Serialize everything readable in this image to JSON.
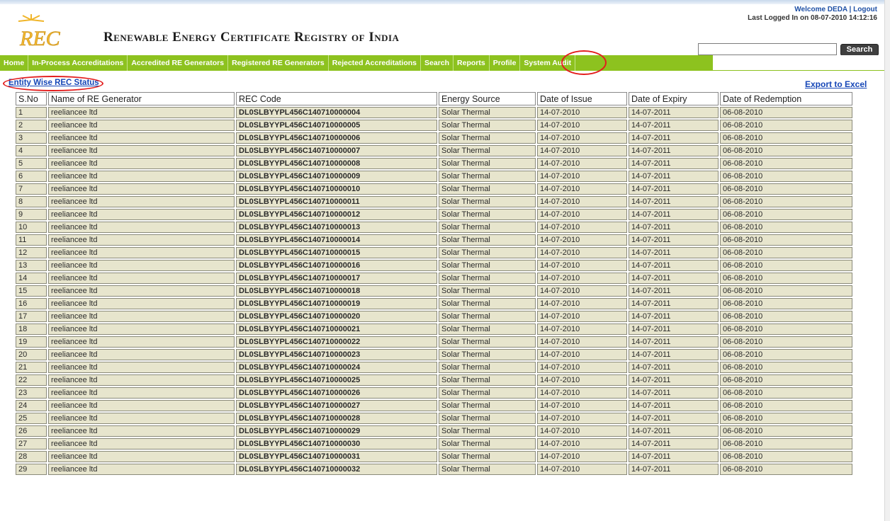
{
  "header": {
    "site_title": "Renewable Energy Certificate Registry of India",
    "welcome_text": "Welcome DEDA",
    "separator": " | ",
    "logout_label": "Logout",
    "last_logged_in": "Last Logged In on 08-07-2010 14:12:16",
    "search_placeholder": "",
    "search_button_label": "Search"
  },
  "nav": [
    "Home",
    "In-Process Accreditations",
    "Accredited RE Generators",
    "Registered RE Generators",
    "Rejected Accreditations",
    "Search",
    "Reports",
    "Profile",
    "System Audit"
  ],
  "page": {
    "heading": "Entity Wise REC Status",
    "export_label": "Export to Excel"
  },
  "colors": {
    "nav_green": "#8dc21f",
    "link_blue": "#1546b7",
    "highlight_red": "#e31d1d",
    "row_bg": "#e7e5cd"
  },
  "table": {
    "columns": [
      "S.No",
      "Name of RE Generator",
      "REC Code",
      "Energy Source",
      "Date of Issue",
      "Date of Expiry",
      "Date of Redemption"
    ],
    "rows": [
      [
        "1",
        "reeliancee ltd",
        "DL0SLBYYPL456C140710000004",
        "Solar Thermal",
        "14-07-2010",
        "14-07-2011",
        "06-08-2010"
      ],
      [
        "2",
        "reeliancee ltd",
        "DL0SLBYYPL456C140710000005",
        "Solar Thermal",
        "14-07-2010",
        "14-07-2011",
        "06-08-2010"
      ],
      [
        "3",
        "reeliancee ltd",
        "DL0SLBYYPL456C140710000006",
        "Solar Thermal",
        "14-07-2010",
        "14-07-2011",
        "06-08-2010"
      ],
      [
        "4",
        "reeliancee ltd",
        "DL0SLBYYPL456C140710000007",
        "Solar Thermal",
        "14-07-2010",
        "14-07-2011",
        "06-08-2010"
      ],
      [
        "5",
        "reeliancee ltd",
        "DL0SLBYYPL456C140710000008",
        "Solar Thermal",
        "14-07-2010",
        "14-07-2011",
        "06-08-2010"
      ],
      [
        "6",
        "reeliancee ltd",
        "DL0SLBYYPL456C140710000009",
        "Solar Thermal",
        "14-07-2010",
        "14-07-2011",
        "06-08-2010"
      ],
      [
        "7",
        "reeliancee ltd",
        "DL0SLBYYPL456C140710000010",
        "Solar Thermal",
        "14-07-2010",
        "14-07-2011",
        "06-08-2010"
      ],
      [
        "8",
        "reeliancee ltd",
        "DL0SLBYYPL456C140710000011",
        "Solar Thermal",
        "14-07-2010",
        "14-07-2011",
        "06-08-2010"
      ],
      [
        "9",
        "reeliancee ltd",
        "DL0SLBYYPL456C140710000012",
        "Solar Thermal",
        "14-07-2010",
        "14-07-2011",
        "06-08-2010"
      ],
      [
        "10",
        "reeliancee ltd",
        "DL0SLBYYPL456C140710000013",
        "Solar Thermal",
        "14-07-2010",
        "14-07-2011",
        "06-08-2010"
      ],
      [
        "11",
        "reeliancee ltd",
        "DL0SLBYYPL456C140710000014",
        "Solar Thermal",
        "14-07-2010",
        "14-07-2011",
        "06-08-2010"
      ],
      [
        "12",
        "reeliancee ltd",
        "DL0SLBYYPL456C140710000015",
        "Solar Thermal",
        "14-07-2010",
        "14-07-2011",
        "06-08-2010"
      ],
      [
        "13",
        "reeliancee ltd",
        "DL0SLBYYPL456C140710000016",
        "Solar Thermal",
        "14-07-2010",
        "14-07-2011",
        "06-08-2010"
      ],
      [
        "14",
        "reeliancee ltd",
        "DL0SLBYYPL456C140710000017",
        "Solar Thermal",
        "14-07-2010",
        "14-07-2011",
        "06-08-2010"
      ],
      [
        "15",
        "reeliancee ltd",
        "DL0SLBYYPL456C140710000018",
        "Solar Thermal",
        "14-07-2010",
        "14-07-2011",
        "06-08-2010"
      ],
      [
        "16",
        "reeliancee ltd",
        "DL0SLBYYPL456C140710000019",
        "Solar Thermal",
        "14-07-2010",
        "14-07-2011",
        "06-08-2010"
      ],
      [
        "17",
        "reeliancee ltd",
        "DL0SLBYYPL456C140710000020",
        "Solar Thermal",
        "14-07-2010",
        "14-07-2011",
        "06-08-2010"
      ],
      [
        "18",
        "reeliancee ltd",
        "DL0SLBYYPL456C140710000021",
        "Solar Thermal",
        "14-07-2010",
        "14-07-2011",
        "06-08-2010"
      ],
      [
        "19",
        "reeliancee ltd",
        "DL0SLBYYPL456C140710000022",
        "Solar Thermal",
        "14-07-2010",
        "14-07-2011",
        "06-08-2010"
      ],
      [
        "20",
        "reeliancee ltd",
        "DL0SLBYYPL456C140710000023",
        "Solar Thermal",
        "14-07-2010",
        "14-07-2011",
        "06-08-2010"
      ],
      [
        "21",
        "reeliancee ltd",
        "DL0SLBYYPL456C140710000024",
        "Solar Thermal",
        "14-07-2010",
        "14-07-2011",
        "06-08-2010"
      ],
      [
        "22",
        "reeliancee ltd",
        "DL0SLBYYPL456C140710000025",
        "Solar Thermal",
        "14-07-2010",
        "14-07-2011",
        "06-08-2010"
      ],
      [
        "23",
        "reeliancee ltd",
        "DL0SLBYYPL456C140710000026",
        "Solar Thermal",
        "14-07-2010",
        "14-07-2011",
        "06-08-2010"
      ],
      [
        "24",
        "reeliancee ltd",
        "DL0SLBYYPL456C140710000027",
        "Solar Thermal",
        "14-07-2010",
        "14-07-2011",
        "06-08-2010"
      ],
      [
        "25",
        "reeliancee ltd",
        "DL0SLBYYPL456C140710000028",
        "Solar Thermal",
        "14-07-2010",
        "14-07-2011",
        "06-08-2010"
      ],
      [
        "26",
        "reeliancee ltd",
        "DL0SLBYYPL456C140710000029",
        "Solar Thermal",
        "14-07-2010",
        "14-07-2011",
        "06-08-2010"
      ],
      [
        "27",
        "reeliancee ltd",
        "DL0SLBYYPL456C140710000030",
        "Solar Thermal",
        "14-07-2010",
        "14-07-2011",
        "06-08-2010"
      ],
      [
        "28",
        "reeliancee ltd",
        "DL0SLBYYPL456C140710000031",
        "Solar Thermal",
        "14-07-2010",
        "14-07-2011",
        "06-08-2010"
      ],
      [
        "29",
        "reeliancee ltd",
        "DL0SLBYYPL456C140710000032",
        "Solar Thermal",
        "14-07-2010",
        "14-07-2011",
        "06-08-2010"
      ]
    ]
  }
}
